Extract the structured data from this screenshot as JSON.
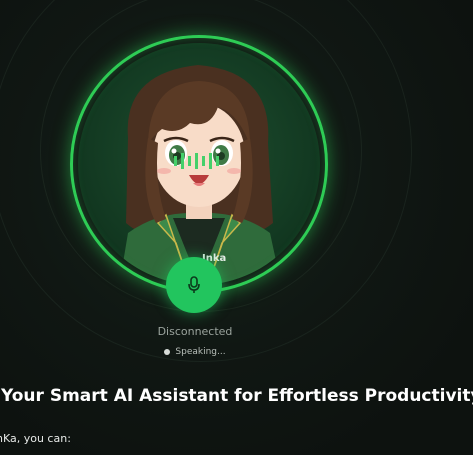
{
  "avatar": {
    "badge_text": "Inka",
    "icon": "anime-girl-avatar"
  },
  "mic": {
    "icon": "microphone-icon"
  },
  "status": {
    "connection": "Disconnected",
    "speaking": "Speaking..."
  },
  "content": {
    "headline": "Your Smart AI Assistant for Effortless Productivity",
    "subline": "nKa, you can:"
  },
  "colors": {
    "accent": "#22c55e",
    "background": "#0f1411"
  }
}
